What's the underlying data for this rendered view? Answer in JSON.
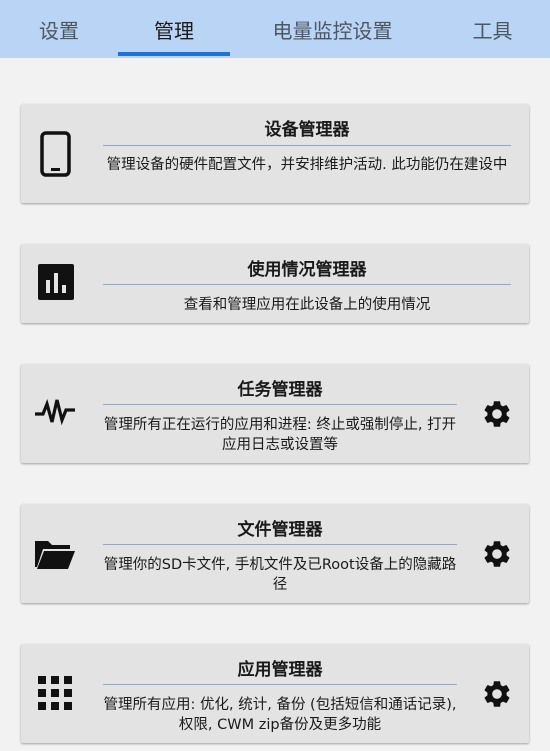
{
  "tabs": [
    {
      "label": "设置"
    },
    {
      "label": "管理"
    },
    {
      "label": "电量监控设置"
    },
    {
      "label": "工具"
    }
  ],
  "cards": [
    {
      "title": "设备管理器",
      "description": "管理设备的硬件配置文件，并安排维护活动. 此功能仍在建设中",
      "icon": "phone-icon"
    },
    {
      "title": "使用情况管理器",
      "description": "查看和管理应用在此设备上的使用情况",
      "icon": "bar-chart-icon"
    },
    {
      "title": "任务管理器",
      "description": "管理所有正在运行的应用和进程: 终止或强制停止, 打开应用日志或设置等",
      "icon": "activity-icon",
      "action_icon": "gear-icon"
    },
    {
      "title": "文件管理器",
      "description": "管理你的SD卡文件, 手机文件及已Root设备上的隐藏路径",
      "icon": "folder-open-icon",
      "action_icon": "gear-icon"
    },
    {
      "title": "应用管理器",
      "description": "管理所有应用: 优化, 统计, 备份 (包括短信和通话记录), 权限, CWM zip备份及更多功能",
      "icon": "apps-grid-icon",
      "action_icon": "gear-icon"
    }
  ],
  "colors": {
    "tab_bar": "#b9d4f4",
    "tab_indicator": "#1e73d6",
    "card_background": "#e3e3e3",
    "page_background": "#f2f2f2"
  }
}
